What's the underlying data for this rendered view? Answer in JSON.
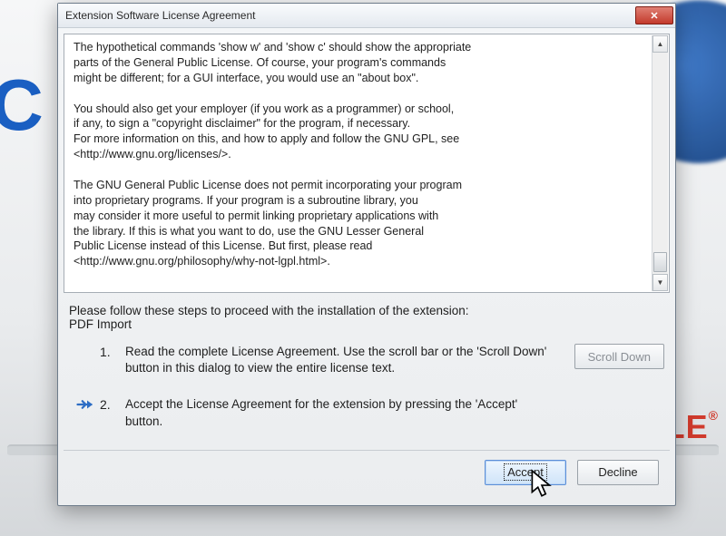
{
  "dialog": {
    "title": "Extension Software License Agreement",
    "license_text": "The hypothetical commands 'show w' and 'show c' should show the appropriate\nparts of the General Public License.  Of course, your program's commands\nmight be different; for a GUI interface, you would use an \"about box\".\n\n  You should also get your employer (if you work as a programmer) or school,\nif any, to sign a \"copyright disclaimer\" for the program, if necessary.\nFor more information on this, and how to apply and follow the GNU GPL, see\n<http://www.gnu.org/licenses/>.\n\n  The GNU General Public License does not permit incorporating your program\ninto proprietary programs.  If your program is a subroutine library, you\nmay consider it more useful to permit linking proprietary applications with\nthe library.  If this is what you want to do, use the GNU Lesser General\nPublic License instead of this License.  But first, please read\n<http://www.gnu.org/philosophy/why-not-lgpl.html>.",
    "instructions_line1": "Please follow these steps to proceed with the installation of the extension:",
    "instructions_line2": "PDF Import",
    "steps": [
      {
        "number": "1.",
        "text": "Read the complete License Agreement. Use the scroll bar or the 'Scroll Down' button in this dialog to view the entire license text.",
        "current": false
      },
      {
        "number": "2.",
        "text": "Accept the License Agreement for the extension by pressing the 'Accept' button.",
        "current": true
      }
    ],
    "buttons": {
      "scroll_down": "Scroll Down",
      "accept": "Accept",
      "decline": "Decline"
    },
    "scroll_down_enabled": false
  }
}
